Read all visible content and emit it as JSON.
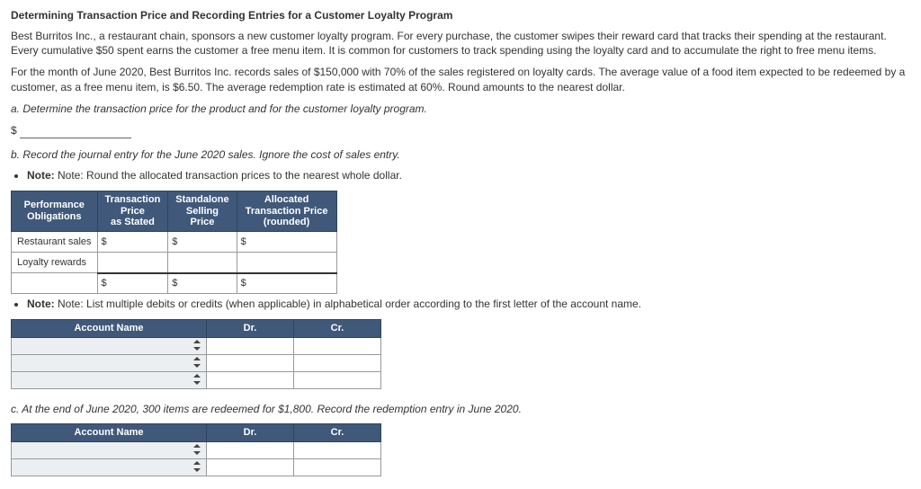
{
  "title": "Determining Transaction Price and Recording Entries for a Customer Loyalty Program",
  "para1": "Best Burritos Inc., a restaurant chain, sponsors a new customer loyalty program. For every purchase, the customer swipes their reward card that tracks their spending at the restaurant. Every cumulative $50 spent earns the customer a free menu item. It is common for customers to track spending using the loyalty card and to accumulate the right to free menu items.",
  "para2": "For the month of June 2020, Best Burritos Inc. records sales of $150,000 with 70% of the sales registered on loyalty cards. The average value of a food item expected to be redeemed by a customer, as a free menu item, is $6.50. The average redemption rate is estimated at 60%. Round amounts to the nearest dollar.",
  "partA": "a. Determine the transaction price for the product and for the customer loyalty program.",
  "dollar": "$",
  "partB": "b. Record the journal entry for the June 2020 sales. Ignore the cost of sales entry.",
  "noteB": "Note: Round the allocated transaction prices to the nearest whole dollar.",
  "table1": {
    "h1a": "Performance",
    "h1b": "Obligations",
    "h2a": "Transaction",
    "h2b": "Price",
    "h2c": "as Stated",
    "h3a": "Standalone",
    "h3b": "Selling",
    "h3c": "Price",
    "h4a": "Allocated",
    "h4b": "Transaction Price",
    "h4c": "(rounded)",
    "row1": "Restaurant sales",
    "row2": "Loyalty rewards"
  },
  "noteList": "Note: List multiple debits or credits (when applicable) in alphabetical order according to the first letter of the account name.",
  "table2": {
    "h1": "Account Name",
    "h2": "Dr.",
    "h3": "Cr."
  },
  "partC": "c. At the end of June 2020, 300 items are redeemed for $1,800. Record the redemption entry in June 2020.",
  "table3": {
    "h1": "Account Name",
    "h2": "Dr.",
    "h3": "Cr."
  }
}
